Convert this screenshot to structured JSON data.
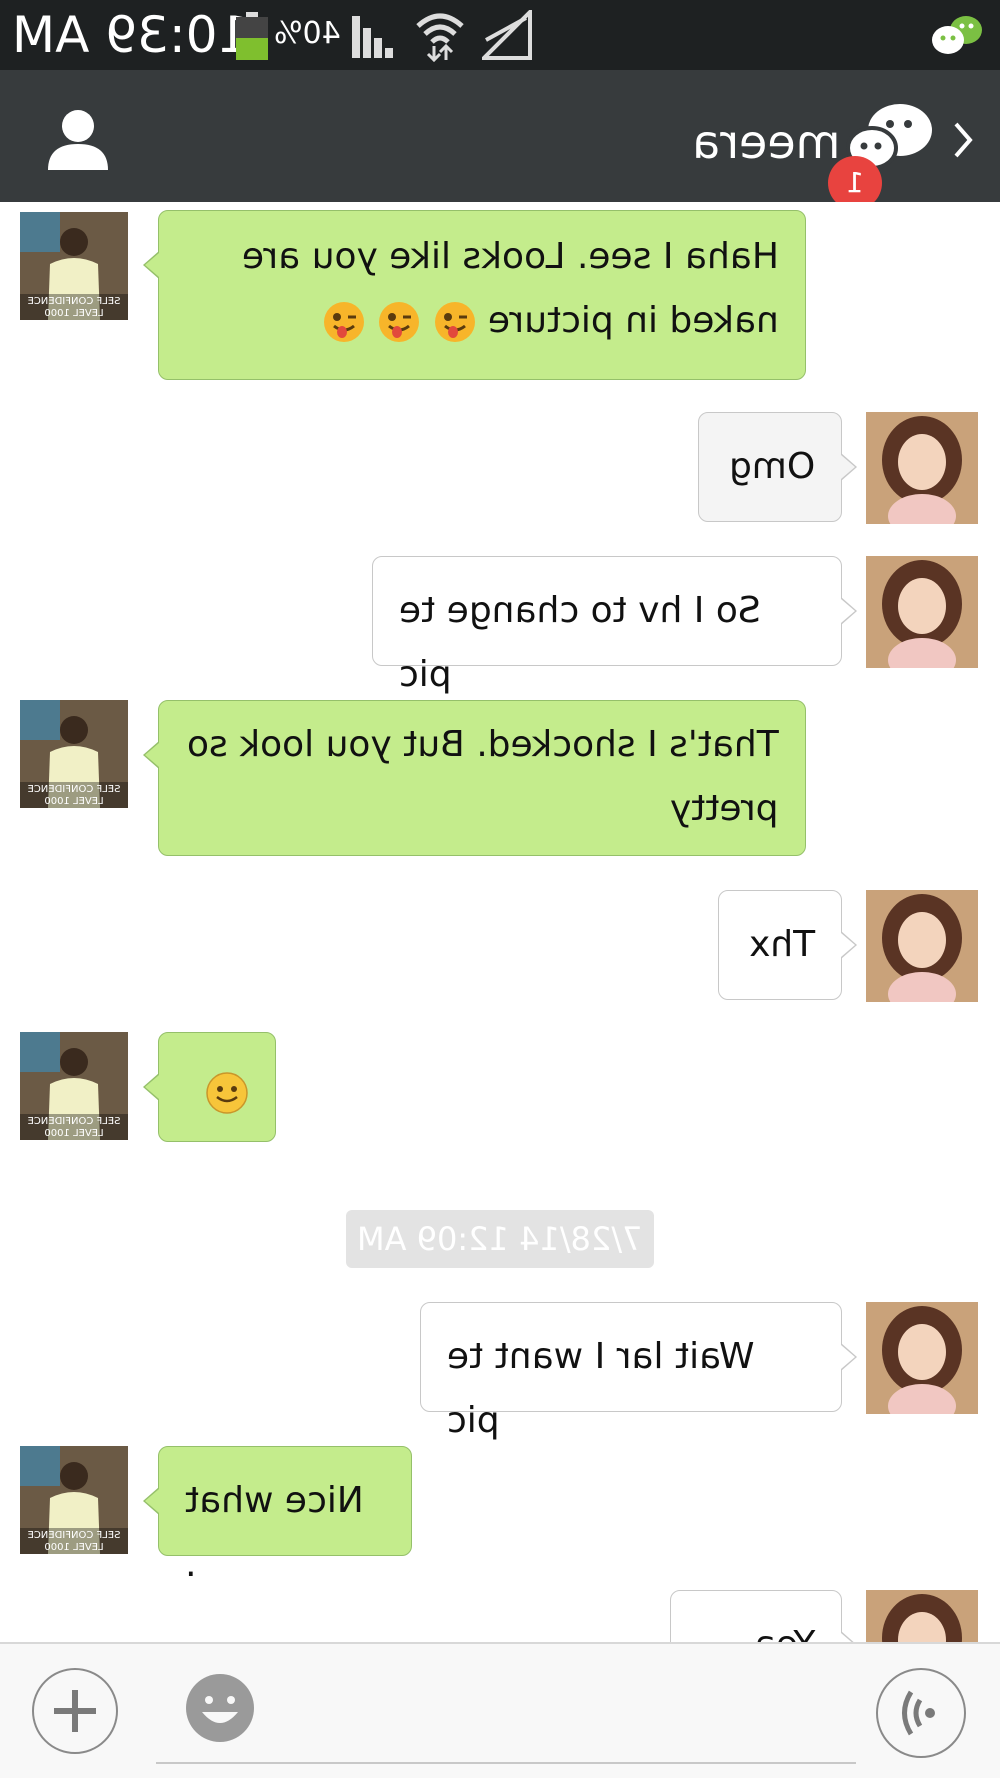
{
  "status_bar": {
    "time": "10:39 AM",
    "battery_percent": "40%",
    "battery_level": 0.4,
    "icons": [
      "battery-icon",
      "signal-icon",
      "wifi-icon",
      "mobile-data-off-icon",
      "wechat-notification-icon"
    ]
  },
  "header": {
    "title": "meera",
    "unread_badge": "1",
    "icons": [
      "person-icon",
      "wechat-icon",
      "back-chevron-icon"
    ]
  },
  "messages": [
    {
      "sender": "contact",
      "avatar": "avatar-contact",
      "text_lines": [
        "Haha I see. Looks like you are",
        "naked in picture"
      ],
      "emoji": [
        "winking-tongue-emoji",
        "winking-tongue-emoji",
        "winking-tongue-emoji"
      ]
    },
    {
      "sender": "me",
      "avatar": "avatar-me",
      "text_lines": [
        "Omg"
      ]
    },
    {
      "sender": "me",
      "avatar": "avatar-me",
      "text_lines": [
        "So I hv to change te pic"
      ]
    },
    {
      "sender": "contact",
      "avatar": "avatar-contact",
      "text_lines": [
        "That's I shocked. But you look so",
        "pretty"
      ]
    },
    {
      "sender": "me",
      "avatar": "avatar-me",
      "text_lines": [
        "Thx"
      ]
    },
    {
      "sender": "contact",
      "avatar": "avatar-contact",
      "text_lines": [],
      "emoji": [
        "smiley-emoji"
      ]
    },
    {
      "sender": "me",
      "avatar": "avatar-me",
      "text_lines": [
        "Wait lar I want te pic"
      ]
    },
    {
      "sender": "contact",
      "avatar": "avatar-contact",
      "text_lines": [
        "Nice what ."
      ]
    },
    {
      "sender": "me",
      "avatar": "avatar-me",
      "text_lines": [
        "Yea"
      ]
    }
  ],
  "avatar_caption": [
    "SELF CONFIDENCE",
    "LEVEL 1000"
  ],
  "timestamp": "7/28/14 12:09 AM",
  "input_bar": {
    "value": "",
    "icons": [
      "plus-icon",
      "emoji-icon",
      "voice-icon"
    ]
  },
  "colors": {
    "status_bar_bg": "#1e2122",
    "title_bar_bg": "#373b3d",
    "green_bubble": "#c4ec8c",
    "white_bubble": "#ffffff",
    "badge": "#e8433f"
  }
}
